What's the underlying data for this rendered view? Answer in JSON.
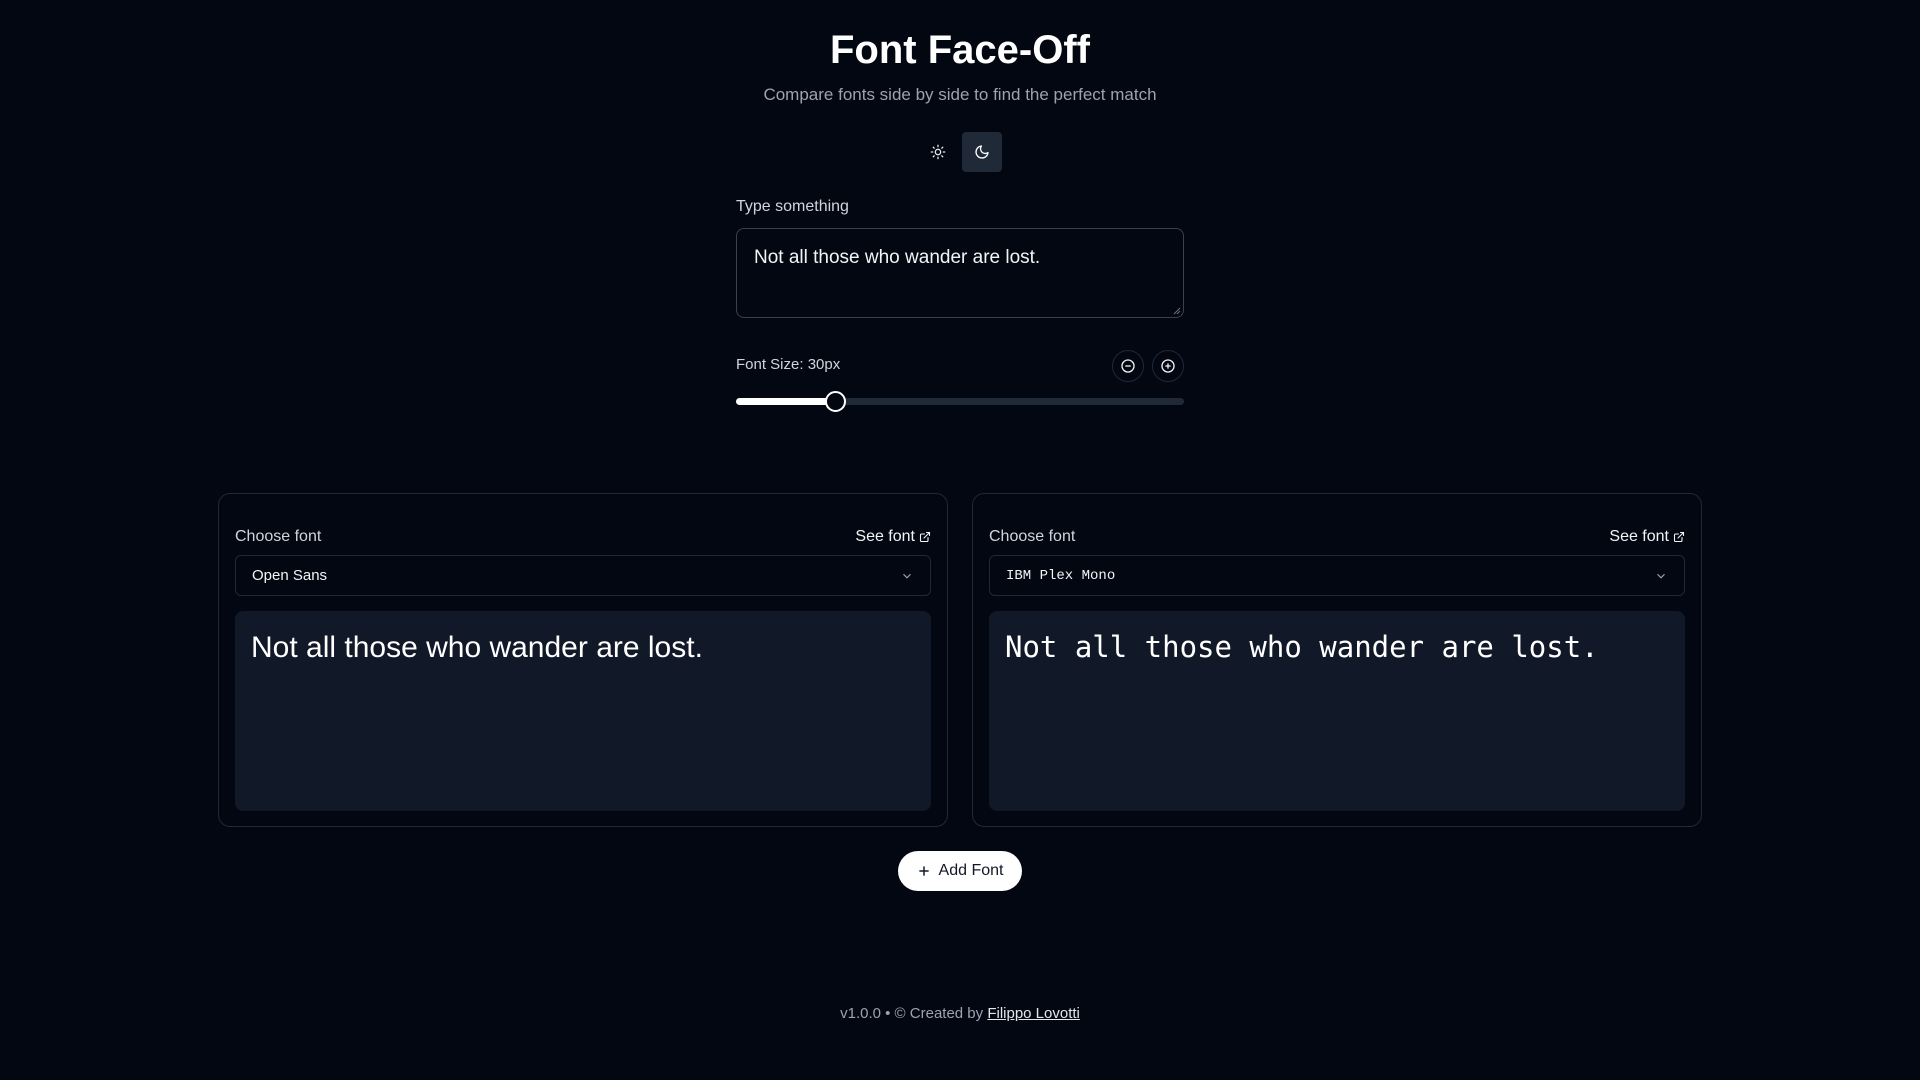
{
  "header": {
    "title": "Font Face-Off",
    "subtitle": "Compare fonts side by side to find the perfect match"
  },
  "theme": {
    "options": [
      {
        "icon": "sun-icon",
        "active": false
      },
      {
        "icon": "moon-icon",
        "active": true
      }
    ]
  },
  "input": {
    "label": "Type something",
    "value": "Not all those who wander are lost."
  },
  "font_size": {
    "label": "Font Size: 30px",
    "value": 30,
    "slider_fraction": 0.22,
    "decrease_icon": "minus-circle-icon",
    "increase_icon": "plus-circle-icon"
  },
  "cards": [
    {
      "choose_label": "Choose font",
      "see_font_label": "See font",
      "selected_font": "Open Sans",
      "preview_text": "Not all those who wander are lost."
    },
    {
      "choose_label": "Choose font",
      "see_font_label": "See font",
      "selected_font": "IBM Plex Mono",
      "preview_text": "Not all those who wander are lost."
    }
  ],
  "add_font": {
    "label": "Add Font"
  },
  "footer": {
    "prefix": "v1.0.0 • © Created by",
    "author": "Filippo Lovotti"
  },
  "colors": {
    "background": "#030712",
    "card_preview": "#111827",
    "accent": "#ffffff"
  }
}
